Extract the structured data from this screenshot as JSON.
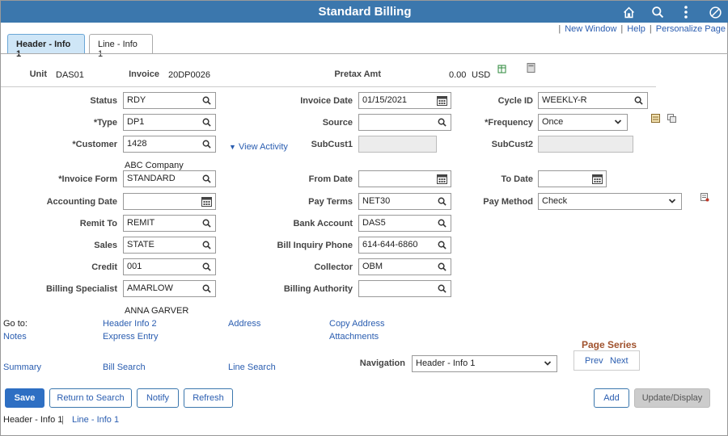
{
  "app": {
    "title": "Standard Billing"
  },
  "header_icons": [
    "home-icon",
    "search-icon",
    "more-icon",
    "block-icon"
  ],
  "tabs": [
    {
      "label": "Header - Info 1",
      "active": true
    },
    {
      "label": "Line - Info 1",
      "active": false
    }
  ],
  "toplinks": {
    "new_window": "New Window",
    "help": "Help",
    "personalize": "Personalize Page"
  },
  "summary": {
    "unit_label": "Unit",
    "unit_value": "DAS01",
    "invoice_label": "Invoice",
    "invoice_value": "20DP0026",
    "pretax_label": "Pretax Amt",
    "pretax_value": "0.00",
    "currency": "USD"
  },
  "form": {
    "status": {
      "label": "Status",
      "value": "RDY"
    },
    "type": {
      "label": "*Type",
      "value": "DP1"
    },
    "customer": {
      "label": "*Customer",
      "value": "1428",
      "name": "ABC Company"
    },
    "view_activity": "View Activity",
    "invoice_form": {
      "label": "*Invoice Form",
      "value": "STANDARD"
    },
    "accounting_date": {
      "label": "Accounting Date",
      "value": ""
    },
    "remit_to": {
      "label": "Remit To",
      "value": "REMIT"
    },
    "sales": {
      "label": "Sales",
      "value": "STATE"
    },
    "credit": {
      "label": "Credit",
      "value": "001"
    },
    "billing_specialist": {
      "label": "Billing Specialist",
      "value": "AMARLOW",
      "name": "ANNA GARVER"
    },
    "invoice_date": {
      "label": "Invoice Date",
      "value": "01/15/2021"
    },
    "source": {
      "label": "Source",
      "value": ""
    },
    "subcust1": {
      "label": "SubCust1",
      "value": ""
    },
    "from_date": {
      "label": "From Date",
      "value": ""
    },
    "pay_terms": {
      "label": "Pay Terms",
      "value": "NET30"
    },
    "bank_account": {
      "label": "Bank Account",
      "value": "DAS5"
    },
    "bill_inquiry_phone": {
      "label": "Bill Inquiry Phone",
      "value": "614-644-6860"
    },
    "collector": {
      "label": "Collector",
      "value": "OBM"
    },
    "billing_authority": {
      "label": "Billing Authority",
      "value": ""
    },
    "cycle_id": {
      "label": "Cycle ID",
      "value": "WEEKLY-R"
    },
    "frequency": {
      "label": "*Frequency",
      "value": "Once"
    },
    "subcust2": {
      "label": "SubCust2",
      "value": ""
    },
    "to_date": {
      "label": "To Date",
      "value": ""
    },
    "pay_method": {
      "label": "Pay Method",
      "value": "Check"
    }
  },
  "goto": {
    "label": "Go to:",
    "links": [
      "Notes",
      "Header Info 2",
      "Express Entry",
      "Address",
      "Copy Address",
      "Attachments",
      "Summary",
      "Bill Search",
      "Line Search"
    ]
  },
  "navigation": {
    "label": "Navigation",
    "value": "Header - Info 1"
  },
  "page_series": {
    "label": "Page Series",
    "prev": "Prev",
    "next": "Next"
  },
  "buttons": {
    "save": "Save",
    "return": "Return to Search",
    "notify": "Notify",
    "refresh": "Refresh",
    "add": "Add",
    "update": "Update/Display"
  },
  "footer": {
    "header_link": "Header - Info 1",
    "line_link": "Line - Info 1"
  }
}
